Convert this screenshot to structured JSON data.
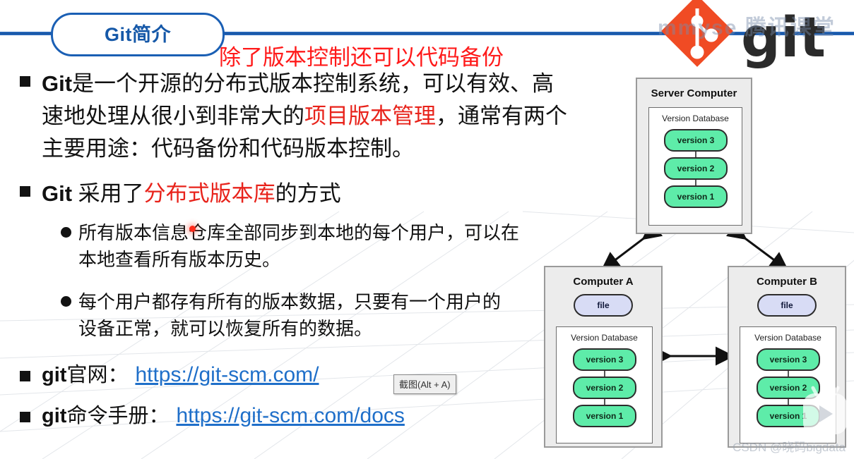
{
  "slide": {
    "title": "Git简介",
    "accent_color": "#1558a8",
    "red_color": "#e8231b",
    "link_color": "#1f6fc9"
  },
  "header": {
    "logo_wordmark": "git",
    "logo_watermark": "mmyse 腾讯课堂"
  },
  "annotation": {
    "red_note": "除了版本控制还可以代码备份"
  },
  "content": {
    "bullet1": {
      "marker": "square",
      "parts": [
        {
          "text": "Git",
          "style": "latin"
        },
        {
          "text": "是一个开源的分布式版本控制系统，可以有效、高速地处理从很小到非常大的",
          "style": "normal"
        },
        {
          "text": "项目版本管理",
          "style": "red"
        },
        {
          "text": "，通常有两个主要用途：代码备份和代码版本控制。",
          "style": "normal"
        }
      ]
    },
    "bullet2": {
      "marker": "square",
      "parts": [
        {
          "text": "Git ",
          "style": "latin"
        },
        {
          "text": "采用了",
          "style": "normal"
        },
        {
          "text": "分布式版本库",
          "style": "red"
        },
        {
          "text": "的方式",
          "style": "normal"
        }
      ]
    },
    "sub_bullets": [
      {
        "marker": "circle",
        "text": "所有版本信息仓库全部同步到本地的每个用户，可以在本地查看所有版本历史。"
      },
      {
        "marker": "circle",
        "text": "每个用户都存有所有的版本数据，只要有一个用户的设备正常，就可以恢复所有的数据。"
      }
    ],
    "links": [
      {
        "marker": "square",
        "latin": "git",
        "label": "官网：",
        "url_text": "https://git-scm.com/"
      },
      {
        "marker": "square",
        "latin": "git",
        "label": "命令手册：",
        "url_text": "https://git-scm.com/docs"
      }
    ]
  },
  "tooltip": {
    "text": "截图(Alt + A)"
  },
  "diagram": {
    "server": {
      "title": "Server Computer",
      "db_title": "Version Database",
      "versions": [
        "version 3",
        "version 2",
        "version 1"
      ]
    },
    "computer_a": {
      "title": "Computer A",
      "file_label": "file",
      "db_title": "Version Database",
      "versions": [
        "version 3",
        "version 2",
        "version 1"
      ]
    },
    "computer_b": {
      "title": "Computer B",
      "file_label": "file",
      "db_title": "Version Database",
      "versions": [
        "version 3",
        "version 2",
        "version 1"
      ]
    },
    "colors": {
      "version_fill": "#5eeca9",
      "file_fill": "#d8dcf5",
      "box_fill": "#ececec"
    }
  },
  "watermark": {
    "credit": "CSDN @晓码bigdata"
  }
}
